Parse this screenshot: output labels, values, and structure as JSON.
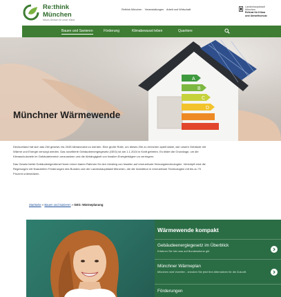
{
  "header": {
    "logo_line1": "Re:think",
    "logo_line2": "München",
    "logo_tagline": "Neues Denken für unser Klima",
    "topnav": [
      "Rethink München",
      "Veranstaltungen",
      "Arbeit und Wirtschaft"
    ],
    "lhm_lines": [
      "Landeshauptstadt",
      "München",
      "Referat für Klima",
      "und Umweltschutz"
    ]
  },
  "mainnav": {
    "items": [
      "Bauen und Sanieren",
      "Förderung",
      "Klimabewusst leben",
      "Quartiere"
    ],
    "active": "Bauen und Sanieren"
  },
  "hero": {
    "title": "Münchner Wärmewende",
    "energy_labels": [
      "A",
      "B",
      "C",
      "D"
    ]
  },
  "intro": {
    "lines": [
      "Deutschland hat sich das Ziel gesetzt, bis 2045 klimaneutral zu werden. Eine große Rolle, um dieses Ziel zu erreichen spielt dabei, wie unsere Gebäude mit",
      "Wärme und Energie versorgt werden. Das novellierte Gebäudeenergiegesetz (GEG) ist am 1.1.2024 in Kraft getreten. Es bildet die Grundlage, um die",
      "Klimaschutzziele im Gebäudebereich umzusetzen und die Abhängigkeit von fossilen Energieträgern zu verringern.",
      "Das Gesetz bietet Gebäudeeigentümer*innen einen klaren Rahmen für den Umstieg von fossilen auf erneuerbare Heizungstechnologien. Verknüpft sind die",
      "Regelungen mit finanziellen Förderungen des Bundes und der Landeshauptstadt München, die die Investition in erneuerbare Technologien mit bis zu 70",
      "Prozent unterstützen."
    ]
  },
  "breadcrumb": {
    "home": "Startseite",
    "section": "Bauen und Sanieren",
    "separator": "»",
    "current": "GEG: Wärmeplanung"
  },
  "kompakt": {
    "title": "Wärmewende kompakt",
    "items": [
      {
        "heading": "Gebäudeenergiegesetz im Überblick",
        "sub": "Erfahren Sie hier was auf Bundesebene gilt."
      },
      {
        "heading": "Münchner Wärmeplan",
        "sub": "München wird Vorreiter - checken Sie jetzt Ihre Alternativen für die Zukunft."
      },
      {
        "heading": "Förderungen",
        "sub": ""
      }
    ]
  },
  "colors": {
    "brand_green": "#3e7d33",
    "kompakt_green": "#2a6c44",
    "link_blue": "#1d4f9a"
  },
  "icons": [
    "logo-leaf-icon",
    "munich-coat-icon",
    "search-icon",
    "arrow-right-icon"
  ]
}
